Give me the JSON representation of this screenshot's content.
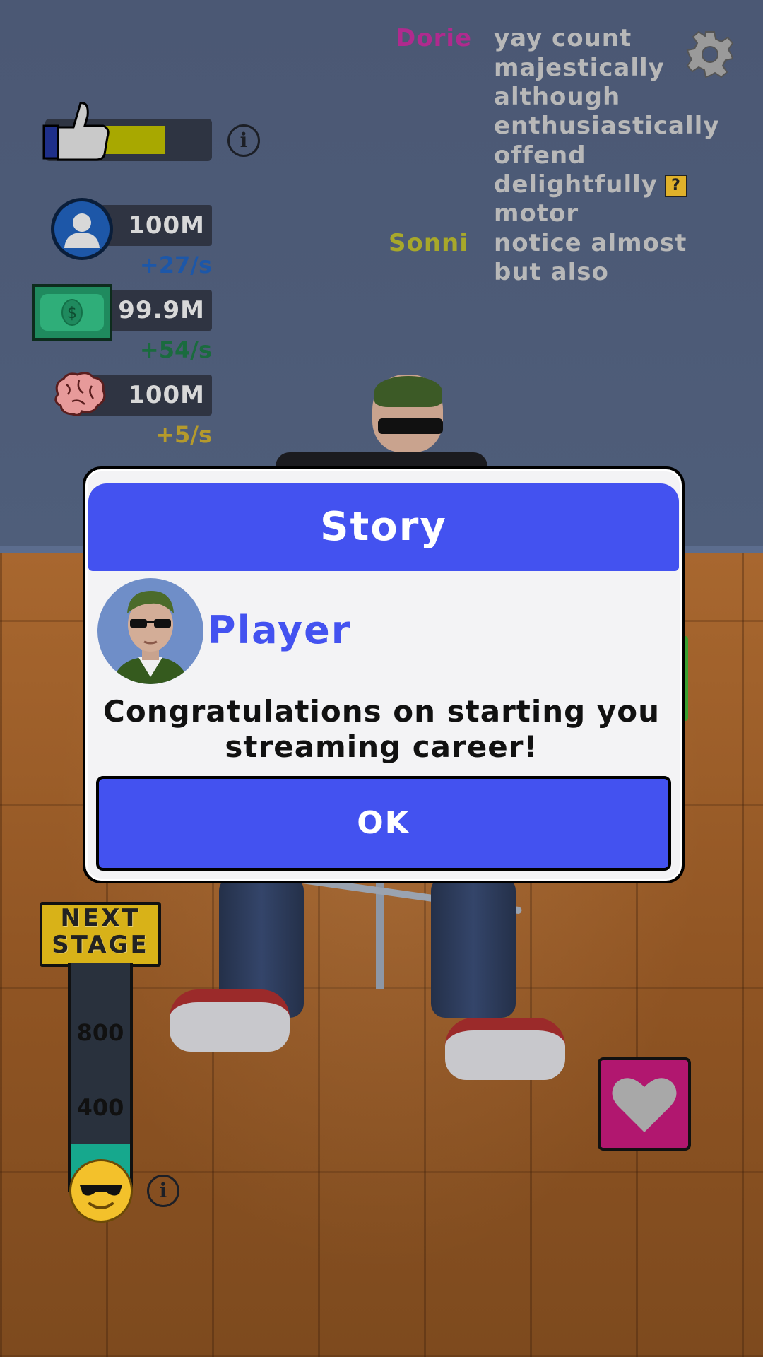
{
  "hud": {
    "like_fraction": 0.62,
    "followers": {
      "value": "100M",
      "rate": "+27/s",
      "rate_color": "#1d57a8"
    },
    "money": {
      "value": "99.9M",
      "rate": "+54/s",
      "rate_color": "#1a6b3e"
    },
    "brain": {
      "value": "100M",
      "rate": "+5/s",
      "rate_color": "#b59a2c"
    }
  },
  "chat": [
    {
      "name": "Dorie",
      "name_color": "#b02a8e",
      "lines": [
        "yay count",
        "majestically",
        "although",
        "enthusiastically",
        "offend",
        "delightfully",
        "motor"
      ]
    },
    {
      "name": "Sonni",
      "name_color": "#a8a82a",
      "lines": [
        "notice almost",
        "but also"
      ]
    }
  ],
  "chat_badge": "?",
  "next_stage": {
    "line1": "NEXT",
    "line2": "STAGE",
    "mark_800": "800",
    "mark_400": "400",
    "fill_fraction": 0.2
  },
  "dialog": {
    "title": "Story",
    "speaker": "Player",
    "message_line1": "Congratulations on starting you",
    "message_line2": "streaming career!",
    "ok_label": "OK"
  },
  "colors": {
    "dialog_accent": "#4352f0",
    "heart_button": "#b1176f"
  },
  "icons": [
    "thumbs-up-icon",
    "info-icon",
    "user-icon",
    "money-icon",
    "brain-icon",
    "gear-icon",
    "heart-icon",
    "sunglasses-emoji-icon",
    "question-badge-icon"
  ]
}
